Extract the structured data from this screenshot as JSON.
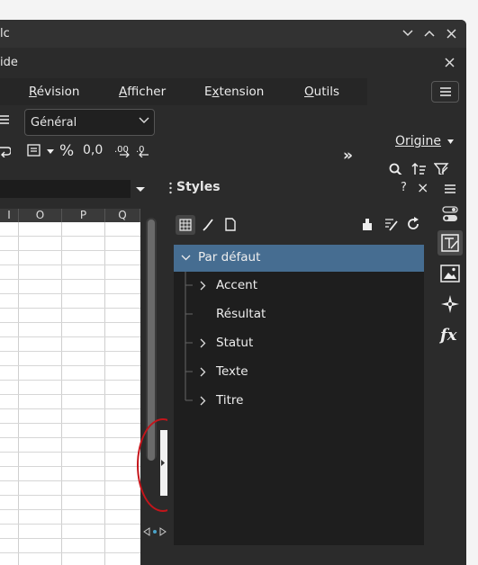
{
  "titlebar": {
    "title": "lc"
  },
  "document": {
    "title": "ide"
  },
  "menu": {
    "tabs": [
      "Révision",
      "Afficher",
      "Extension",
      "Outils"
    ],
    "underline": [
      "R",
      "A",
      "x",
      "O"
    ]
  },
  "toolbar": {
    "number_format": "Général",
    "percent": "%",
    "decimal": "0,0",
    "more": "»",
    "origin": "Origine"
  },
  "sheet": {
    "columns": [
      "I",
      "O",
      "P",
      "Q"
    ]
  },
  "panel": {
    "title": "Styles",
    "help": "?",
    "close": "×",
    "root": "Par défaut",
    "items": [
      "Accent",
      "Résultat",
      "Statut",
      "Texte",
      "Titre"
    ]
  },
  "colors": {
    "selection": "#466d91",
    "annotation": "#c4151b"
  }
}
